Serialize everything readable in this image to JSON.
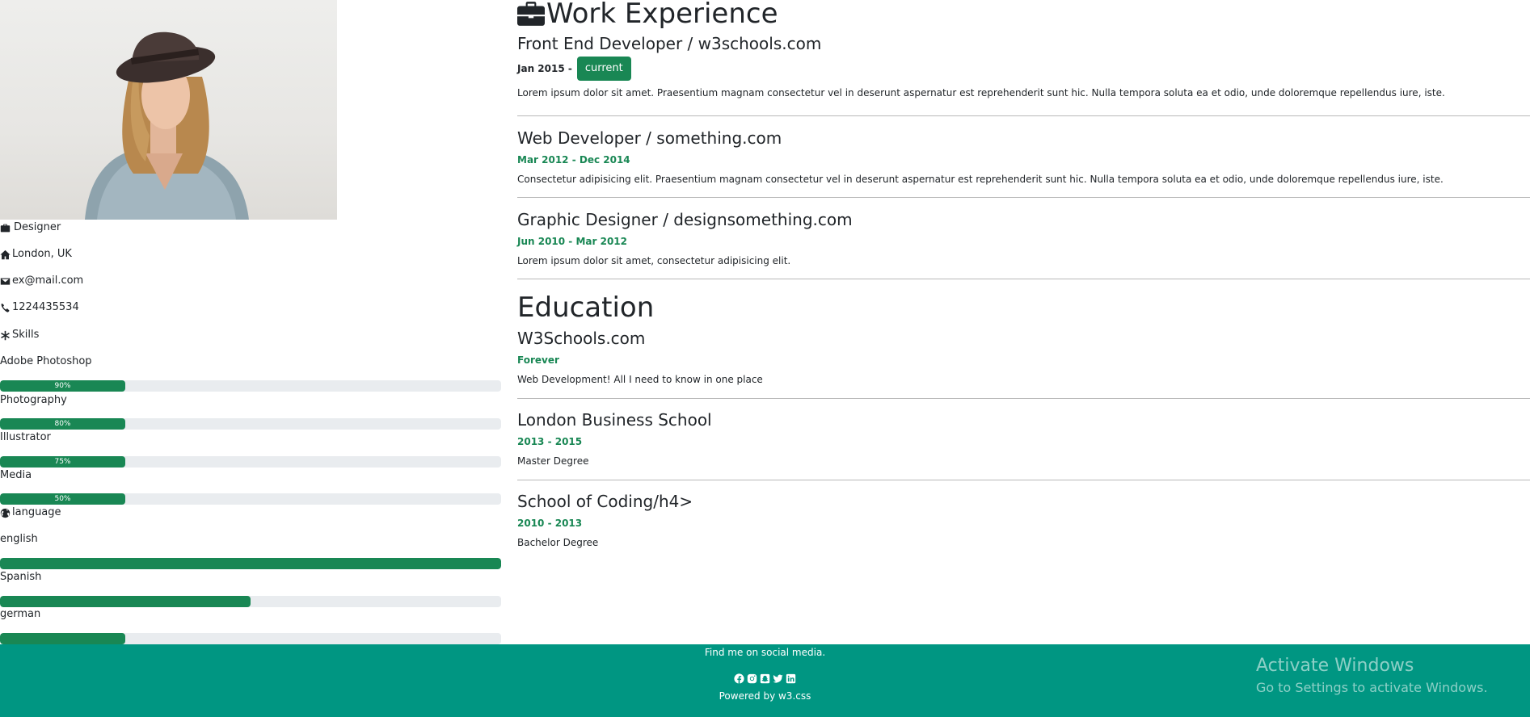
{
  "sidebar": {
    "job_title": "Designer",
    "location": "London, UK",
    "email": "ex@mail.com",
    "phone": "1224435534",
    "skills_heading": "Skills",
    "skills": [
      {
        "name": "Adobe Photoshop",
        "percent": 90,
        "label": "90%"
      },
      {
        "name": "Photography",
        "percent": 80,
        "label": "80%"
      },
      {
        "name": "Illustrator",
        "percent": 75,
        "label": "75%"
      },
      {
        "name": "Media",
        "percent": 50,
        "label": "50%"
      }
    ],
    "language_heading": "language",
    "languages": [
      {
        "name": "english",
        "percent": 100
      },
      {
        "name": "Spanish",
        "percent": 50
      },
      {
        "name": "german",
        "percent": 25
      }
    ]
  },
  "work": {
    "heading": "Work Experience",
    "entries": [
      {
        "title": "Front End Developer / w3schools.com",
        "date": "Jan 2015 -",
        "badge": "current",
        "desc": "Lorem ipsum dolor sit amet. Praesentium magnam consectetur vel in deserunt aspernatur est reprehenderit sunt hic. Nulla tempora soluta ea et odio, unde doloremque repellendus iure, iste."
      },
      {
        "title": "Web Developer / something.com",
        "date": "Mar 2012 - Dec 2014",
        "desc": "Consectetur adipisicing elit. Praesentium magnam consectetur vel in deserunt aspernatur est reprehenderit sunt hic. Nulla tempora soluta ea et odio, unde doloremque repellendus iure, iste."
      },
      {
        "title": "Graphic Designer / designsomething.com",
        "date": "Jun 2010 - Mar 2012",
        "desc": "Lorem ipsum dolor sit amet, consectetur adipisicing elit."
      }
    ]
  },
  "education": {
    "heading": "Education",
    "entries": [
      {
        "title": "W3Schools.com",
        "date": "Forever",
        "desc": "Web Development! All I need to know in one place"
      },
      {
        "title": "London Business School",
        "date": "2013 - 2015",
        "desc": "Master Degree"
      },
      {
        "title": "School of Coding/h4>",
        "date": "2010 - 2013",
        "desc": "Bachelor Degree"
      }
    ]
  },
  "footer": {
    "social_text": "Find me on social media.",
    "social_icons": [
      "facebook-icon",
      "instagram-icon",
      "snapchat-icon",
      "twitter-icon",
      "linkedin-icon"
    ],
    "powered": "Powered by w3.css"
  },
  "watermark": {
    "title": "Activate Windows",
    "subtitle": "Go to Settings to activate Windows."
  },
  "colors": {
    "accent": "#198754",
    "footer_bg": "#009682",
    "track": "#e9ecef"
  }
}
